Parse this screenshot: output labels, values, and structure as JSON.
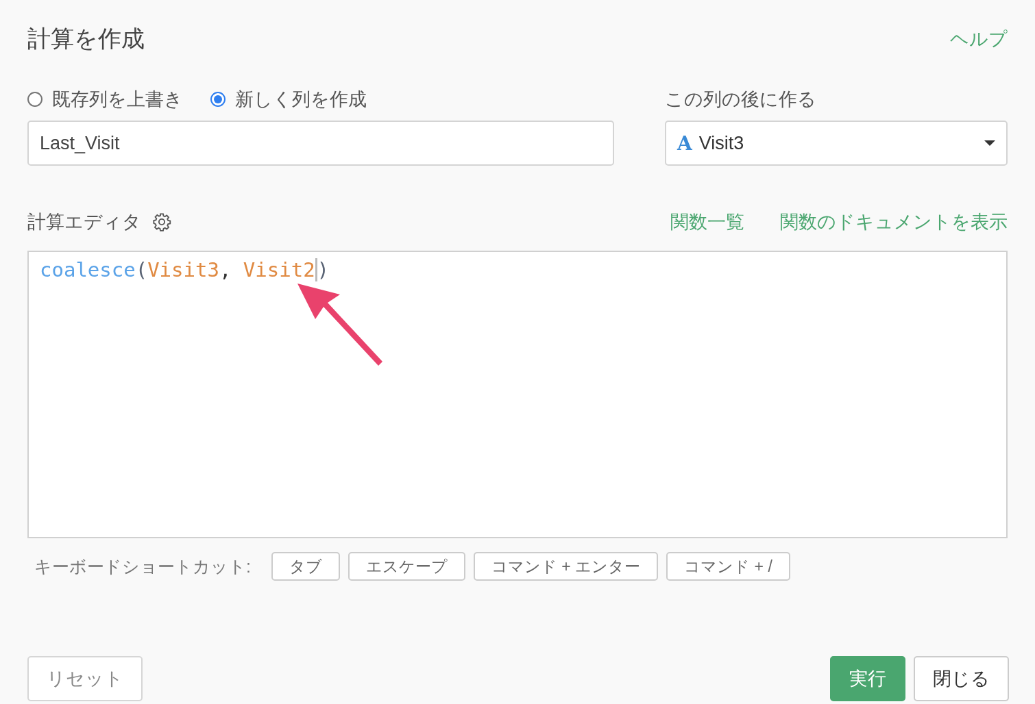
{
  "dialog": {
    "title": "計算を作成",
    "help_link": "ヘルプ"
  },
  "mode_options": [
    {
      "label": "既存列を上書き",
      "selected": false
    },
    {
      "label": "新しく列を作成",
      "selected": true
    }
  ],
  "column_name": {
    "value": "Last_Visit"
  },
  "insert_after": {
    "label": "この列の後に作る",
    "type_icon": "A",
    "value": "Visit3"
  },
  "editor": {
    "label": "計算エディタ",
    "links": [
      "関数一覧",
      "関数のドキュメントを表示"
    ],
    "tokens": [
      {
        "text": "coalesce",
        "kind": "function",
        "cursor": false
      },
      {
        "text": "(",
        "kind": "paren",
        "cursor": false
      },
      {
        "text": "Visit3",
        "kind": "column",
        "cursor": false
      },
      {
        "text": ", ",
        "kind": "punct",
        "cursor": false
      },
      {
        "text": "Visit2",
        "kind": "column",
        "cursor": true
      },
      {
        "text": ")",
        "kind": "paren",
        "cursor": false
      }
    ]
  },
  "shortcuts": {
    "label": "キーボードショートカット:",
    "keys": [
      "タブ",
      "エスケープ",
      "コマンド + エンター",
      "コマンド + /"
    ]
  },
  "buttons": [
    {
      "label": "リセット",
      "kind": "secondary"
    },
    {
      "label": "実行",
      "kind": "primary"
    },
    {
      "label": "閉じる",
      "kind": "default"
    }
  ]
}
